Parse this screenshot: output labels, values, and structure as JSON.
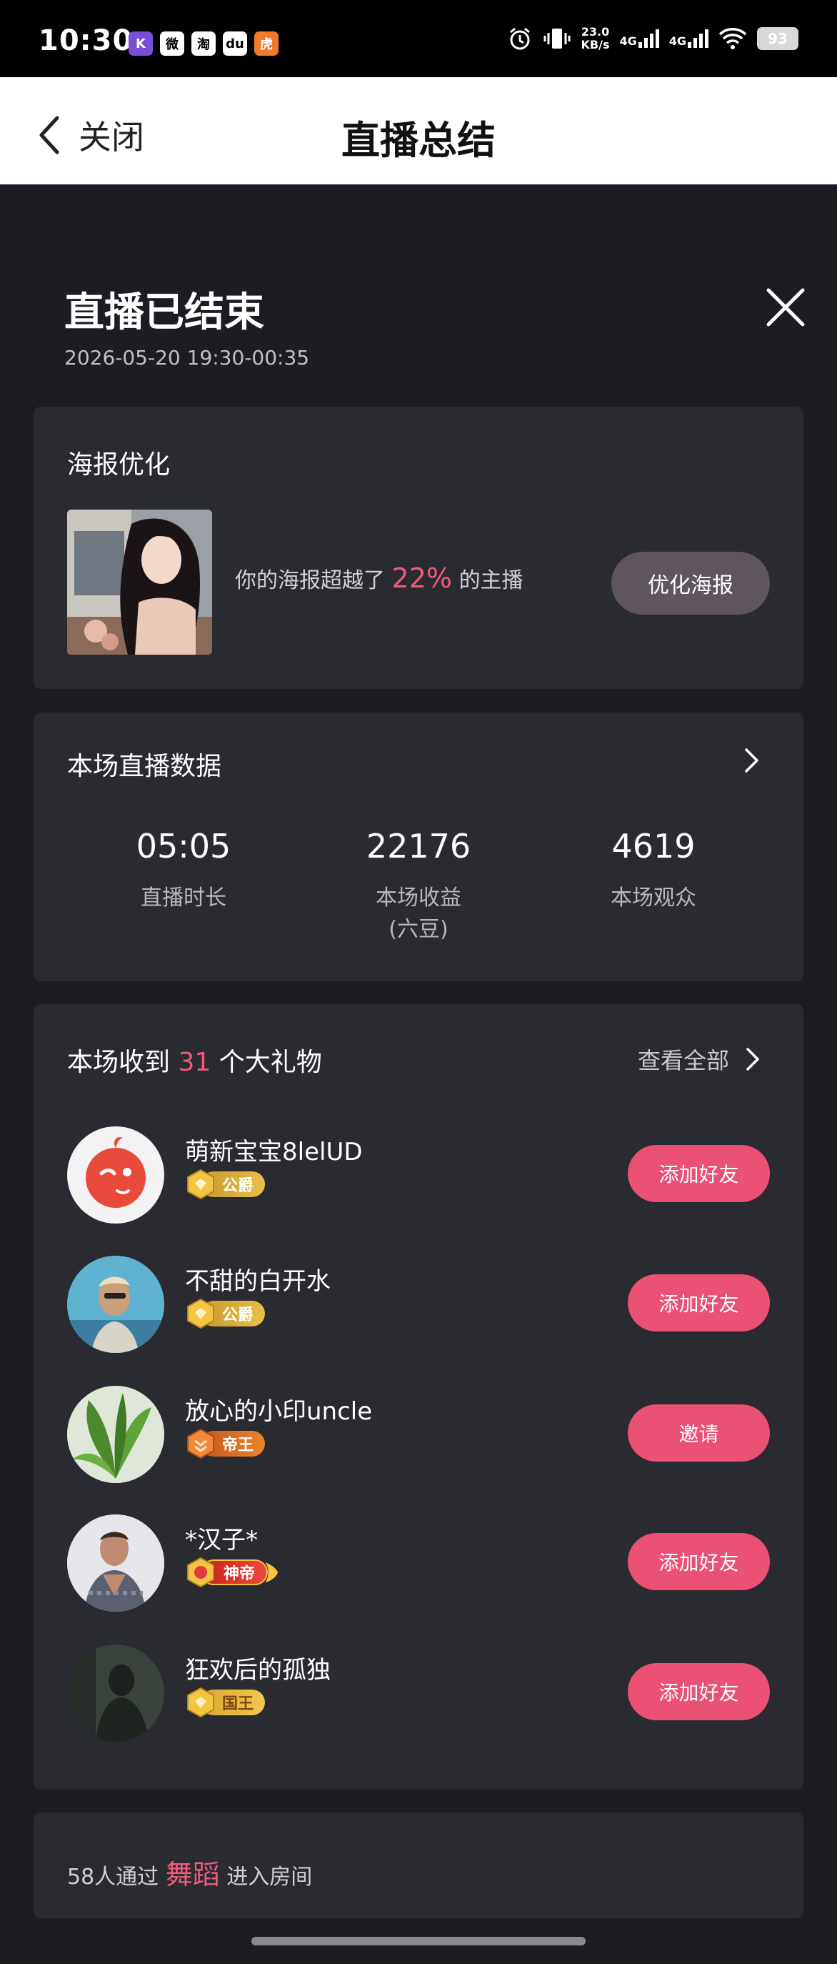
{
  "status_bar": {
    "time": "10:30",
    "apps": [
      "K",
      "微",
      "淘",
      "du",
      "虎"
    ],
    "net_speed_value": "23.0",
    "net_speed_unit": "KB/s",
    "network_1": "4G",
    "network_2": "4G",
    "battery": "93"
  },
  "header": {
    "back_label": "关闭",
    "title": "直播总结"
  },
  "ended": {
    "title": "直播已结束",
    "time_range": "2026-05-20 19:30-00:35"
  },
  "poster": {
    "title": "海报优化",
    "text_prefix": "你的海报超越了",
    "percent": "22%",
    "text_suffix": "的主播",
    "button": "优化海报"
  },
  "stats": {
    "title": "本场直播数据",
    "items": [
      {
        "value": "05:05",
        "label": "直播时长",
        "sub": ""
      },
      {
        "value": "22176",
        "label": "本场收益",
        "sub": "(六豆)"
      },
      {
        "value": "4619",
        "label": "本场观众",
        "sub": ""
      }
    ]
  },
  "gifts": {
    "title_prefix": "本场收到",
    "count": "31",
    "title_suffix": "个大礼物",
    "view_all": "查看全部",
    "users": [
      {
        "name": "萌新宝宝8lelUD",
        "badge": "公爵",
        "action": "添加好友"
      },
      {
        "name": "不甜的白开水",
        "badge": "公爵",
        "action": "添加好友"
      },
      {
        "name": "放心的小印uncle",
        "badge": "帝王",
        "action": "邀请"
      },
      {
        "name": "*汉子*",
        "badge": "神帝",
        "action": "添加好友"
      },
      {
        "name": "狂欢后的孤独",
        "badge": "国王",
        "action": "添加好友"
      }
    ]
  },
  "entry": {
    "prefix": "58人通过",
    "source": "舞蹈",
    "suffix": "进入房间"
  },
  "colors": {
    "accent": "#ea5174",
    "background": "#1c1c22",
    "card": "#2a2a31",
    "badge_gold": "#e3b340",
    "badge_orange": "#e07a2a",
    "badge_red": "#e23a3a"
  }
}
